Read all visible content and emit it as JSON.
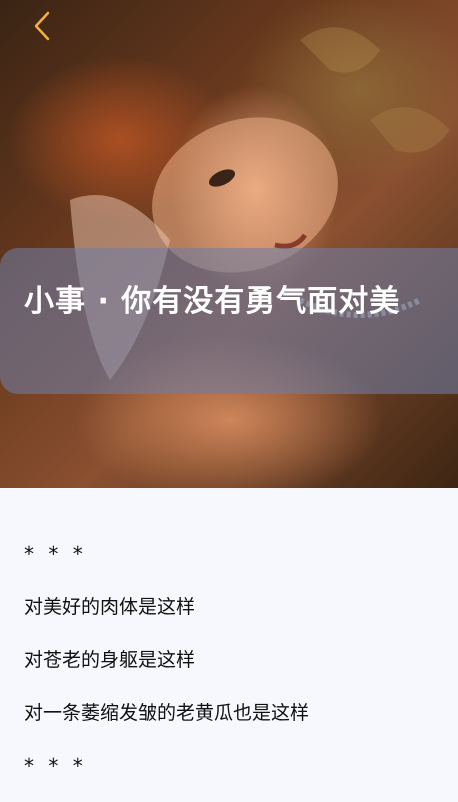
{
  "header": {
    "back_icon": "chevron-left-icon",
    "accent_color": "#f3b03a"
  },
  "article": {
    "title": "小事 · 你有没有勇气面对美",
    "lines": [
      "* * *",
      "对美好的肉体是这样",
      "对苍老的身躯是这样",
      "对一条萎缩发皱的老黄瓜也是这样",
      "* * *"
    ]
  }
}
